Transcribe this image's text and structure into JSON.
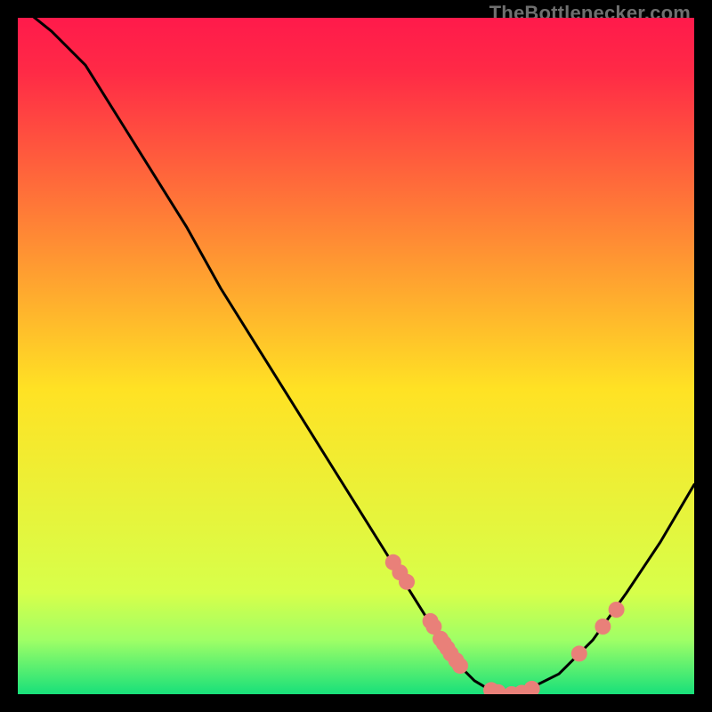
{
  "watermark": "TheBottlenecker.com",
  "colors": {
    "gradient_top": "#ff1a4b",
    "gradient_mid": "#ffe224",
    "gradient_low1": "#d7ff4a",
    "gradient_low2": "#9fff66",
    "gradient_bottom": "#18e07a",
    "curve": "#000000",
    "markers": "#e98079",
    "frame_bg": "#000000"
  },
  "chart_data": {
    "type": "line",
    "title": "",
    "xlabel": "",
    "ylabel": "",
    "x": [
      0.0,
      0.05,
      0.1,
      0.15,
      0.2,
      0.25,
      0.3,
      0.35,
      0.4,
      0.45,
      0.5,
      0.55,
      0.6,
      0.625,
      0.65,
      0.675,
      0.7,
      0.725,
      0.75,
      0.8,
      0.85,
      0.9,
      0.95,
      1.0
    ],
    "y": [
      1.02,
      0.98,
      0.93,
      0.85,
      0.77,
      0.69,
      0.6,
      0.52,
      0.44,
      0.36,
      0.28,
      0.2,
      0.12,
      0.08,
      0.045,
      0.02,
      0.005,
      0.0,
      0.005,
      0.03,
      0.08,
      0.15,
      0.225,
      0.31
    ],
    "xlim": [
      0,
      1
    ],
    "ylim": [
      0,
      1
    ],
    "markers": [
      {
        "x": 0.555,
        "y": 0.195
      },
      {
        "x": 0.565,
        "y": 0.18
      },
      {
        "x": 0.575,
        "y": 0.166
      },
      {
        "x": 0.61,
        "y": 0.108
      },
      {
        "x": 0.615,
        "y": 0.1
      },
      {
        "x": 0.625,
        "y": 0.082
      },
      {
        "x": 0.63,
        "y": 0.075
      },
      {
        "x": 0.635,
        "y": 0.068
      },
      {
        "x": 0.64,
        "y": 0.06
      },
      {
        "x": 0.648,
        "y": 0.05
      },
      {
        "x": 0.654,
        "y": 0.042
      },
      {
        "x": 0.7,
        "y": 0.006
      },
      {
        "x": 0.71,
        "y": 0.003
      },
      {
        "x": 0.73,
        "y": 0.0
      },
      {
        "x": 0.745,
        "y": 0.002
      },
      {
        "x": 0.76,
        "y": 0.008
      },
      {
        "x": 0.83,
        "y": 0.06
      },
      {
        "x": 0.865,
        "y": 0.1
      },
      {
        "x": 0.885,
        "y": 0.125
      }
    ],
    "gradient_stops": [
      {
        "offset": 0.0,
        "color": "#ff1a4b"
      },
      {
        "offset": 0.08,
        "color": "#ff2a46"
      },
      {
        "offset": 0.55,
        "color": "#ffe224"
      },
      {
        "offset": 0.85,
        "color": "#d7ff4a"
      },
      {
        "offset": 0.92,
        "color": "#9fff66"
      },
      {
        "offset": 1.0,
        "color": "#18e07a"
      }
    ]
  }
}
